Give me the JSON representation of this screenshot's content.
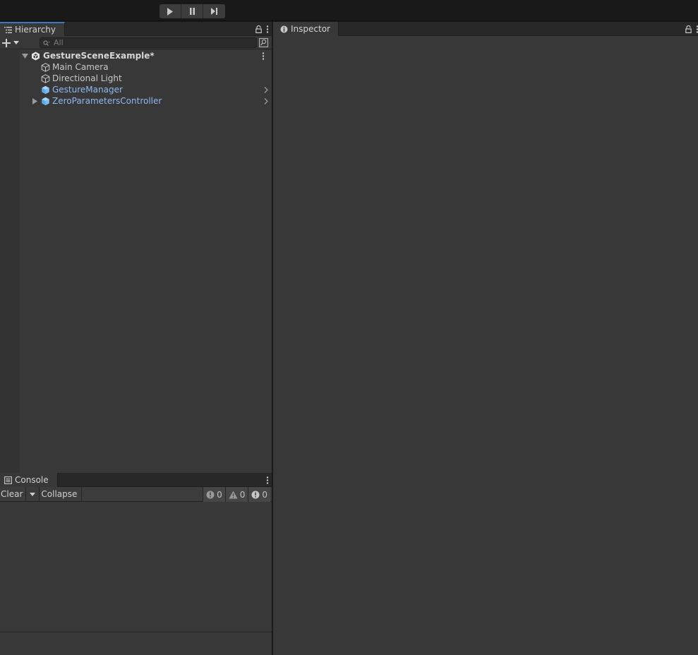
{
  "toolbar": {
    "play_icon": "play-icon",
    "pause_icon": "pause-icon",
    "step_icon": "step-icon"
  },
  "hierarchy": {
    "tab_label": "Hierarchy",
    "search_placeholder": "All",
    "tree": [
      {
        "label": "GestureSceneExample*",
        "kind": "scene",
        "icon": "unity-scene-icon",
        "expanded": true,
        "menu": true
      },
      {
        "label": "Main Camera",
        "kind": "gameobject",
        "icon": "cube-outline-icon"
      },
      {
        "label": "Directional Light",
        "kind": "gameobject",
        "icon": "cube-outline-icon"
      },
      {
        "label": "GestureManager",
        "kind": "prefab",
        "icon": "prefab-cube-icon",
        "chevron": true
      },
      {
        "label": "ZeroParametersController",
        "kind": "prefab",
        "icon": "prefab-cube-icon",
        "collapsed": true,
        "chevron": true
      }
    ]
  },
  "console": {
    "tab_label": "Console",
    "clear_label": "Clear",
    "collapse_label": "Collapse",
    "info_count": "0",
    "warning_count": "0",
    "error_count": "0"
  },
  "inspector": {
    "tab_label": "Inspector"
  },
  "colors": {
    "prefab_text": "#8fb8ef",
    "panel_bg": "#383838",
    "tab_accent": "#3a79bb"
  }
}
